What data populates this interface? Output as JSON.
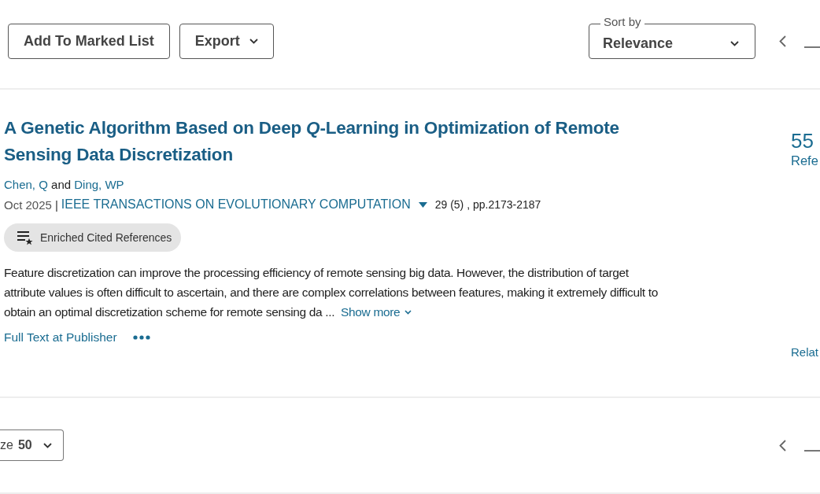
{
  "toolbar": {
    "buttons": [
      {
        "label": "Add To Marked List",
        "kind": "plain"
      },
      {
        "label": "Export",
        "kind": "menu"
      }
    ],
    "sort": {
      "legend": "Sort by",
      "value": "Relevance"
    }
  },
  "record": {
    "title": "A Genetic Algorithm Based on Deep *Q*-Learning in Optimization of Remote Sensing Data Discretization",
    "authors": [
      {
        "name": "Chen, Q"
      },
      {
        "name": "Ding, WP"
      }
    ],
    "author_joiner": "and",
    "date": "Oct 2025",
    "separator": "|",
    "journal": "IEEE TRANSACTIONS ON EVOLUTIONARY COMPUTATION",
    "volume": "29 (5) , pp.2173-2187",
    "badge": "Enriched Cited References",
    "abstract": "Feature discretization can improve the processing efficiency of remote sensing big data. However, the distribution of target attribute values is often difficult to ascertain, and there are complex correlations between features, making it extremely difficult to obtain an optimal discretization scheme for remote sensing da ...",
    "show_more": "Show more",
    "full_text": "Full Text at Publisher",
    "citations": "55",
    "citations_label": "Refe",
    "related": "Relat"
  },
  "pager": {
    "page_size_label": "ze",
    "page_size": "50"
  }
}
